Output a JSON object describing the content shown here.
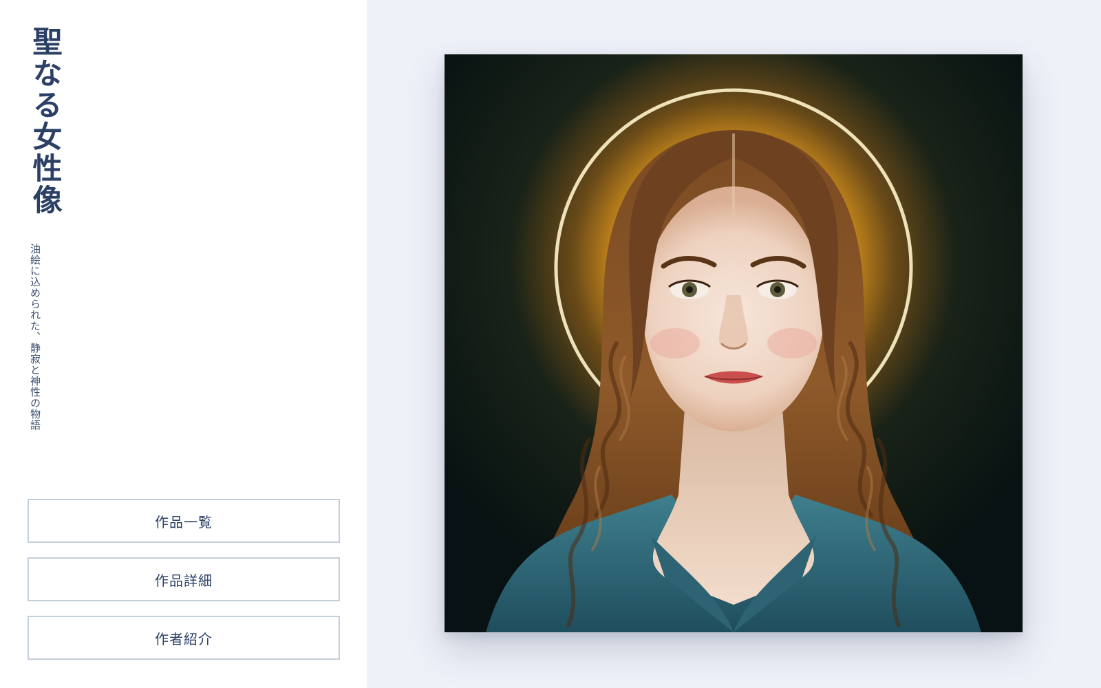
{
  "site": {
    "title": "聖なる女性像",
    "subtitle": "油絵に込められた、静寂と神性の物語"
  },
  "nav": {
    "items": [
      {
        "label": "作品一覧"
      },
      {
        "label": "作品詳細"
      },
      {
        "label": "作者紹介"
      }
    ]
  },
  "artwork": {
    "image": "oil-painting-haloed-woman"
  },
  "colors": {
    "accent": "#2c4066",
    "background": "#eef1f8",
    "sidebar": "#ffffff",
    "button_border": "#c6cedb"
  }
}
